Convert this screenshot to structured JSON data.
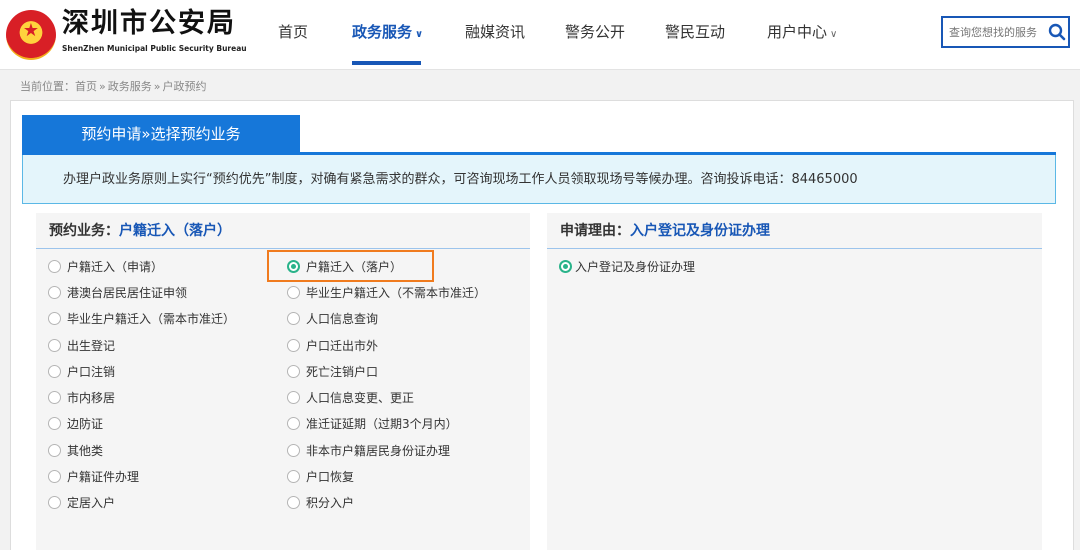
{
  "header": {
    "site_title": "深圳市公安局",
    "site_subtitle": "ShenZhen Municipal Public Security Bureau",
    "nav": [
      {
        "label": "首页"
      },
      {
        "label": "政务服务",
        "chevron": "∨",
        "active": true
      },
      {
        "label": "融媒资讯"
      },
      {
        "label": "警务公开"
      },
      {
        "label": "警民互动"
      },
      {
        "label": "用户中心",
        "chevron": "∨"
      }
    ],
    "search": {
      "placeholder": "查询您想找的服务",
      "icon": "search-icon"
    },
    "brand_color": "#1857b6"
  },
  "breadcrumb": {
    "prefix": "当前位置：",
    "items": [
      "首页",
      "政务服务",
      "户政预约"
    ],
    "separator": "»"
  },
  "main": {
    "tab_label": "预约申请»选择预约业务",
    "notice": "办理户政业务原则上实行“预约优先”制度，对确有紧急需求的群众，可咨询现场工作人员领取现场号等候办理。咨询投诉电话：84465000",
    "business": {
      "heading_label": "预约业务：",
      "heading_value": "户籍迁入（落户）",
      "left_options": [
        "户籍迁入（申请）",
        "港澳台居民居住证申领",
        "毕业生户籍迁入（需本市准迁）",
        "出生登记",
        "户口注销",
        "市内移居",
        "边防证",
        "其他类",
        "户籍证件办理",
        "定居入户"
      ],
      "right_options": [
        "户籍迁入（落户）",
        "毕业生户籍迁入（不需本市准迁）",
        "人口信息查询",
        "户口迁出市外",
        "死亡注销户口",
        "人口信息变更、更正",
        "准迁证延期（过期3个月内）",
        "非本市户籍居民身份证办理",
        "户口恢复",
        "积分入户"
      ],
      "selected": "户籍迁入（落户）"
    },
    "reason": {
      "heading_label": "申请理由：",
      "heading_value": "入户登记及身份证办理",
      "options": [
        "入户登记及身份证办理"
      ],
      "selected": "入户登记及身份证办理"
    },
    "accent_color": "#1677d9",
    "highlight_color": "#f07b1e",
    "radio_selected_color": "#2ab38a"
  }
}
